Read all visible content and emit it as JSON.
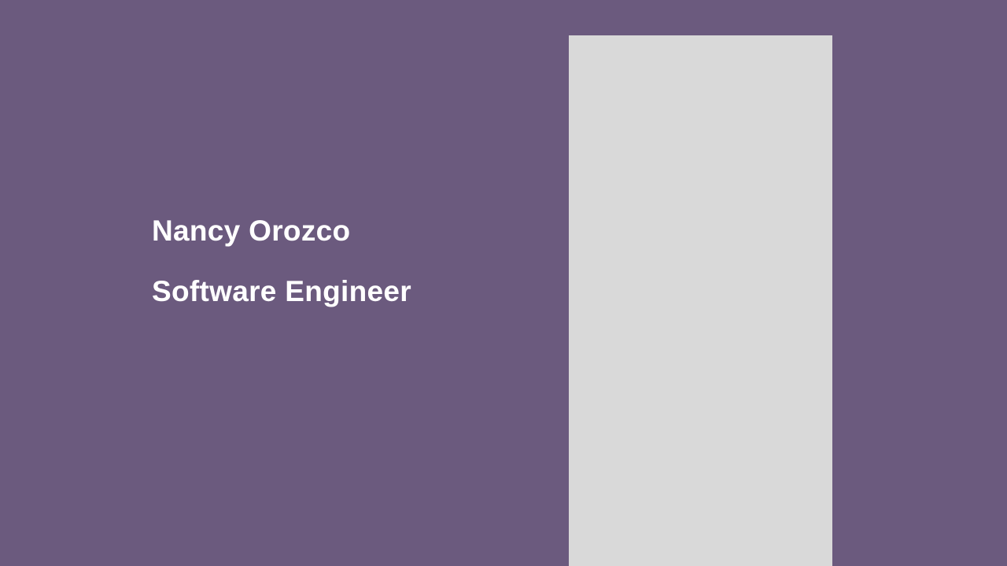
{
  "slide": {
    "background_color": "#6b5a7e",
    "name": "Nancy Orozco",
    "role": "Software Engineer",
    "text_color": "#ffffff",
    "placeholder_color": "#d9d9d9"
  }
}
